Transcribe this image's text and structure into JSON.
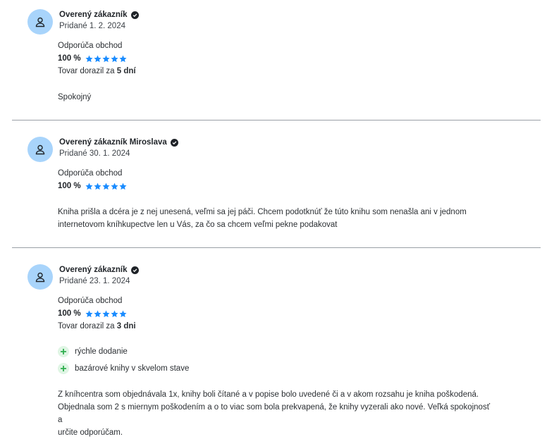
{
  "reviews": [
    {
      "author": "Overený zákazník",
      "date": "Pridané 1. 2. 2024",
      "recommend_label": "Odporúča obchod",
      "percent": "100 %",
      "rating": 5,
      "delivery_prefix": "Tovar dorazil za ",
      "delivery_value": "5 dní",
      "pros": [],
      "text": "Spokojný"
    },
    {
      "author": "Overený zákazník Miroslava",
      "date": "Pridané 30. 1. 2024",
      "recommend_label": "Odporúča obchod",
      "percent": "100 %",
      "rating": 5,
      "text_line1": "Kniha prišla a dcéra je z nej unesená, veľmi sa jej páči. Chcem podotknúť že túto knihu som nenašla ani v jednom",
      "text_line2": "internetovom kníhkupectve len u Vás, za čo sa chcem veľmi pekne podakovat"
    },
    {
      "author": "Overený zákazník",
      "date": "Pridané 23. 1. 2024",
      "recommend_label": "Odporúča obchod",
      "percent": "100 %",
      "rating": 5,
      "delivery_prefix": "Tovar dorazil za ",
      "delivery_value": "3 dni",
      "pros": [
        "rýchle dodanie",
        "bazárové knihy v skvelom stave"
      ],
      "text_line1": "Z kníhcentra som objednávala 1x, knihy boli čítané a v popise bolo uvedené či a v akom rozsahu je kniha poškodená.",
      "text_line2": "Objednala som 2 s miernym poškodením a o to viac som bola prekvapená, že knihy vyzerali ako nové. Veľká spokojnosť a",
      "text_line3": "určite odporúčam."
    }
  ],
  "icons": {
    "avatar": "user-icon",
    "verified": "verified-check-icon",
    "star": "star-icon",
    "pro": "plus-icon"
  },
  "colors": {
    "avatar_bg": "#a8d4fb",
    "star": "#1a8cff",
    "pro_bg": "#dff5e4",
    "pro_plus": "#2fae4e",
    "divider": "#9aa0a6"
  }
}
